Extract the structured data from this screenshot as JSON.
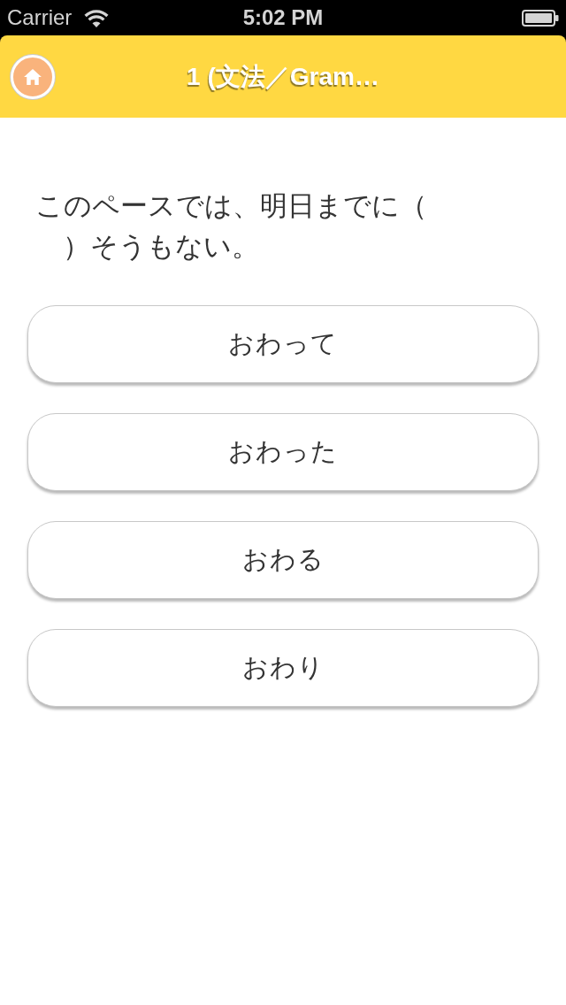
{
  "status_bar": {
    "carrier": "Carrier",
    "time": "5:02 PM"
  },
  "nav_bar": {
    "title": "1 (文法／Gram…"
  },
  "question": {
    "text": "このペースでは、明日までに（）そうもない。"
  },
  "answers": [
    {
      "label": "おわって"
    },
    {
      "label": "おわった"
    },
    {
      "label": "おわる"
    },
    {
      "label": "おわり"
    }
  ]
}
